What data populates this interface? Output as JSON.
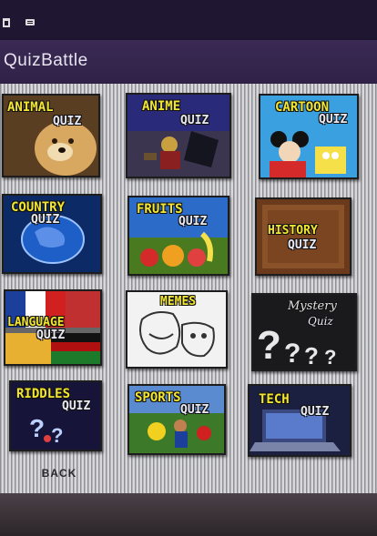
{
  "app": {
    "title": "QuizBattle"
  },
  "status_bar": {
    "icons": [
      "sim-card-icon",
      "message-icon"
    ]
  },
  "quizzes": [
    {
      "id": "animal",
      "line1": "ANIMAL",
      "line2": "QUIZ"
    },
    {
      "id": "anime",
      "line1": "ANIME",
      "line2": "QUIZ"
    },
    {
      "id": "cartoon",
      "line1": "CARTOON",
      "line2": "QUIZ"
    },
    {
      "id": "country",
      "line1": "COUNTRY",
      "line2": "QUIZ"
    },
    {
      "id": "fruits",
      "line1": "FRUITS",
      "line2": "QUIZ"
    },
    {
      "id": "history",
      "line1": "HISTORY",
      "line2": "QUIZ"
    },
    {
      "id": "language",
      "line1": "LANGUAGE",
      "line2": "QUIZ"
    },
    {
      "id": "memes",
      "line1": "MEMES",
      "line2": ""
    },
    {
      "id": "mystery",
      "line1": "Mystery",
      "line2": "Quiz"
    },
    {
      "id": "riddles",
      "line1": "RIDDLES",
      "line2": "QUIZ"
    },
    {
      "id": "sports",
      "line1": "SPORTS",
      "line2": "QUIZ"
    },
    {
      "id": "tech",
      "line1": "TECH",
      "line2": "QUIZ"
    }
  ],
  "footer": {
    "back_label": "BACK"
  }
}
